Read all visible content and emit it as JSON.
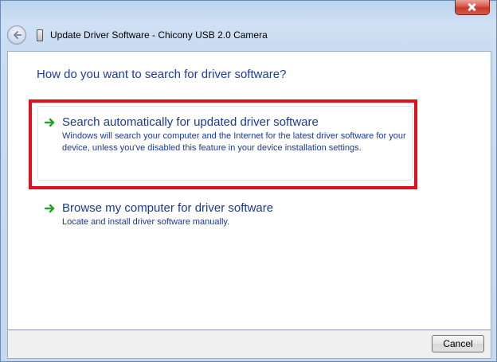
{
  "window": {
    "title": "Update Driver Software - Chicony USB 2.0 Camera"
  },
  "main": {
    "heading": "How do you want to search for driver software?",
    "options": [
      {
        "title": "Search automatically for updated driver software",
        "description": "Windows will search your computer and the Internet for the latest driver software for your device, unless you've disabled this feature in your device installation settings."
      },
      {
        "title": "Browse my computer for driver software",
        "description": "Locate and install driver software manually."
      }
    ]
  },
  "footer": {
    "cancel_label": "Cancel"
  },
  "icons": {
    "back": "back-arrow-icon",
    "device": "usb-device-icon",
    "option": "green-arrow-icon",
    "close": "close-icon"
  },
  "colors": {
    "link_text": "#1c3a8c",
    "heading_text": "#1f3c9a",
    "highlight": "#e0101c",
    "arrow_green": "#2aa12a"
  }
}
